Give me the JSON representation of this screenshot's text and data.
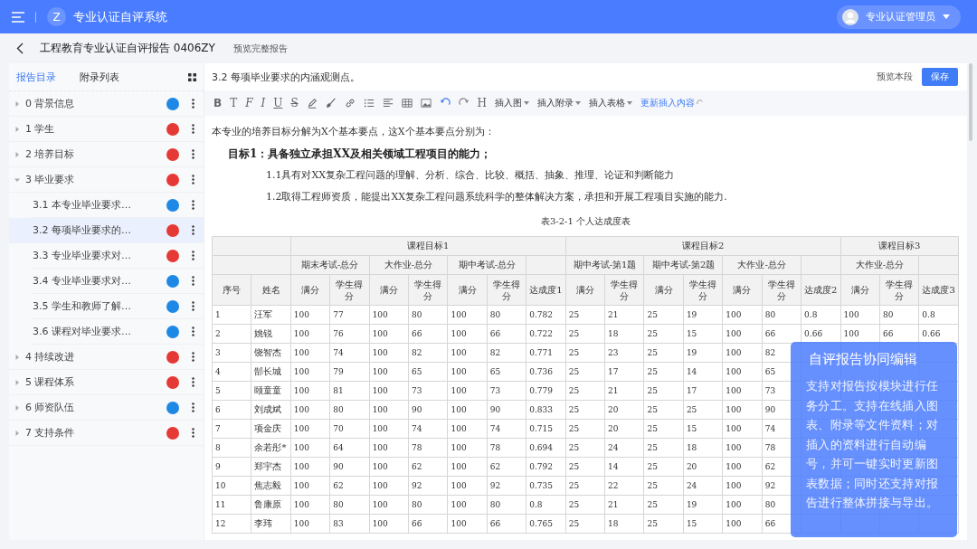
{
  "app": {
    "logo": "Z",
    "title": "专业认证自评系统",
    "user": "专业认证管理员"
  },
  "report": {
    "title": "工程教育专业认证自评报告 0406ZY",
    "preview_link": "预览完整报告"
  },
  "sidebar": {
    "tabs": [
      {
        "label": "报告目录",
        "selected": true
      },
      {
        "label": "附录列表",
        "selected": false
      }
    ],
    "items": [
      {
        "label": "0 背景信息",
        "color": "#1e88e5",
        "expanded": false,
        "selected": false
      },
      {
        "label": "1 学生",
        "color": "#e53935",
        "expanded": false,
        "selected": false
      },
      {
        "label": "2 培养目标",
        "color": "#e53935",
        "expanded": false,
        "selected": false
      },
      {
        "label": "3 毕业要求",
        "color": "#e53935",
        "expanded": true,
        "selected": false,
        "children": [
          {
            "label": "3.1 本专业毕业要求…",
            "color": "#1e88e5",
            "selected": false
          },
          {
            "label": "3.2 每项毕业要求的…",
            "color": "#e53935",
            "selected": true
          },
          {
            "label": "3.3 专业毕业要求对…",
            "color": "#e53935",
            "selected": false
          },
          {
            "label": "3.4 专业毕业要求对…",
            "color": "#1e88e5",
            "selected": false
          },
          {
            "label": "3.5 学生和教师了解…",
            "color": "#1e88e5",
            "selected": false
          },
          {
            "label": "3.6 课程对毕业要求…",
            "color": "#1e88e5",
            "selected": false
          }
        ]
      },
      {
        "label": "4 持续改进",
        "color": "#e53935",
        "expanded": false,
        "selected": false
      },
      {
        "label": "5 课程体系",
        "color": "#e53935",
        "expanded": false,
        "selected": false
      },
      {
        "label": "6 师资队伍",
        "color": "#1e88e5",
        "expanded": false,
        "selected": false
      },
      {
        "label": "7 支持条件",
        "color": "#e53935",
        "expanded": false,
        "selected": false
      }
    ]
  },
  "editor": {
    "section_title": "3.2 每项毕业要求的内涵观测点。",
    "preview_button": "预览本段",
    "save_button": "保存",
    "toolbar": {
      "text_styles": [
        "B",
        "T",
        "F",
        "I",
        "U",
        "S"
      ],
      "heading_glyph": "H",
      "menus": [
        "插入图",
        "插入附录",
        "插入表格"
      ],
      "refresh_link": "更新插入内容"
    },
    "paragraphs": [
      {
        "kind": "plain",
        "text": "本专业的培养目标分解为X个基本要点，这X个基本要点分别为："
      },
      {
        "kind": "goal",
        "text": "目标1：具备独立承担XX及相关领域工程项目的能力；"
      },
      {
        "kind": "point",
        "text": "1.1具有对XX复杂工程问题的理解、分析、综合、比较、概括、抽象、推理、论证和判断能力"
      },
      {
        "kind": "point",
        "text": "1.2取得工程师资质，能提出XX复杂工程问题系统科学的整体解决方案，承担和开展工程项目实施的能力."
      }
    ],
    "table": {
      "caption": "表3-2-1  个人达成度表",
      "header_rows": [
        [
          {},
          {
            "text": "课程目标1"
          },
          {
            "text": "课程目标2"
          },
          {
            "text": "课程目标3"
          }
        ],
        [
          {},
          {
            "text": "期末考试-总分"
          },
          {
            "text": "大作业-总分"
          },
          {
            "text": "期中考试-总分"
          },
          {},
          {
            "text": "期中考试-第1题"
          },
          {
            "text": "期中考试-第2题"
          },
          {
            "text": "大作业-总分"
          },
          {},
          {
            "text": "大作业-总分"
          },
          {}
        ],
        [
          {
            "text": "序号"
          },
          {
            "text": "姓名"
          },
          {
            "text": "满分"
          },
          {
            "text": "学生得分"
          },
          {
            "text": "满分"
          },
          {
            "text": "学生得分"
          },
          {
            "text": "满分"
          },
          {
            "text": "学生得分"
          },
          {
            "text": "达成度1"
          },
          {
            "text": "满分"
          },
          {
            "text": "学生得分"
          },
          {
            "text": "满分"
          },
          {
            "text": "学生得分"
          },
          {
            "text": "满分"
          },
          {
            "text": "学生得分"
          },
          {
            "text": "达成度2"
          },
          {
            "text": "满分"
          },
          {
            "text": "学生得分"
          },
          {
            "text": "达成度3"
          }
        ]
      ],
      "rows": [
        [
          "1",
          "汪军",
          "100",
          "77",
          "100",
          "80",
          "100",
          "80",
          "0.782",
          "25",
          "21",
          "25",
          "19",
          "100",
          "80",
          "0.8",
          "100",
          "80",
          "0.8"
        ],
        [
          "2",
          "姚锐",
          "100",
          "76",
          "100",
          "66",
          "100",
          "66",
          "0.722",
          "25",
          "18",
          "25",
          "15",
          "100",
          "66",
          "0.66",
          "100",
          "66",
          "0.66"
        ],
        [
          "3",
          "饶智杰",
          "100",
          "74",
          "100",
          "82",
          "100",
          "82",
          "0.771",
          "25",
          "23",
          "25",
          "19",
          "100",
          "82"
        ],
        [
          "4",
          "郜长城",
          "100",
          "79",
          "100",
          "65",
          "100",
          "65",
          "0.736",
          "25",
          "17",
          "25",
          "14",
          "100",
          "65"
        ],
        [
          "5",
          "颐童童",
          "100",
          "81",
          "100",
          "73",
          "100",
          "73",
          "0.779",
          "25",
          "21",
          "25",
          "17",
          "100",
          "73"
        ],
        [
          "6",
          "刘成斌",
          "100",
          "80",
          "100",
          "90",
          "100",
          "90",
          "0.833",
          "25",
          "20",
          "25",
          "25",
          "100",
          "90"
        ],
        [
          "7",
          "项金庆",
          "100",
          "70",
          "100",
          "74",
          "100",
          "74",
          "0.715",
          "25",
          "20",
          "25",
          "15",
          "100",
          "74"
        ],
        [
          "8",
          "余若彤*",
          "100",
          "64",
          "100",
          "78",
          "100",
          "78",
          "0.694",
          "25",
          "24",
          "25",
          "18",
          "100",
          "78"
        ],
        [
          "9",
          "郑宇杰",
          "100",
          "90",
          "100",
          "62",
          "100",
          "62",
          "0.792",
          "25",
          "14",
          "25",
          "20",
          "100",
          "62"
        ],
        [
          "10",
          "焦志毅",
          "100",
          "62",
          "100",
          "92",
          "100",
          "92",
          "0.735",
          "25",
          "22",
          "25",
          "24",
          "100",
          "92"
        ],
        [
          "11",
          "鲁康原",
          "100",
          "80",
          "100",
          "80",
          "100",
          "80",
          "0.8",
          "25",
          "21",
          "25",
          "19",
          "100",
          "80"
        ],
        [
          "12",
          "李玮",
          "100",
          "83",
          "100",
          "66",
          "100",
          "66",
          "0.765",
          "25",
          "18",
          "25",
          "15",
          "100",
          "66"
        ]
      ]
    }
  },
  "feature_card": {
    "title": "自评报告协同编辑",
    "text": "支持对报告按模块进行任务分工。支持在线插入图表、附录等文件资料；对插入的资料进行自动编号，并可一键实时更新图表数据；同时还支持对报告进行整体拼接与导出。"
  }
}
